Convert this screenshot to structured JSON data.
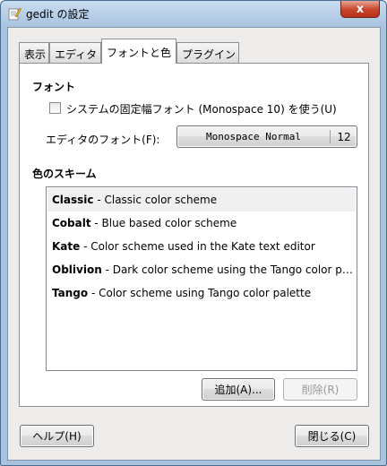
{
  "window": {
    "title": "gedit の設定",
    "close_label": "x"
  },
  "tabs": [
    {
      "label": "表示"
    },
    {
      "label": "エディタ"
    },
    {
      "label": "フォントと色"
    },
    {
      "label": "プラグイン"
    }
  ],
  "font_section": {
    "title": "フォント",
    "checkbox_label": "システムの固定幅フォント (Monospace 10) を使う(U)",
    "checkbox_checked": false,
    "editor_font_label": "エディタのフォント(F):",
    "font_name": "Monospace Normal",
    "font_size": "12"
  },
  "scheme_section": {
    "title": "色のスキーム",
    "items": [
      {
        "name": "Classic",
        "desc": " - Classic color scheme"
      },
      {
        "name": "Cobalt",
        "desc": " - Blue based color scheme"
      },
      {
        "name": "Kate",
        "desc": " - Color scheme used in the Kate text editor"
      },
      {
        "name": "Oblivion",
        "desc": " - Dark color scheme using the Tango color pa…"
      },
      {
        "name": "Tango",
        "desc": " - Color scheme using Tango color palette"
      }
    ],
    "selected_index": 0,
    "add_button": "追加(A)...",
    "remove_button": "削除(R)"
  },
  "footer": {
    "help_button": "ヘルプ(H)",
    "close_button": "閉じる(C)"
  }
}
